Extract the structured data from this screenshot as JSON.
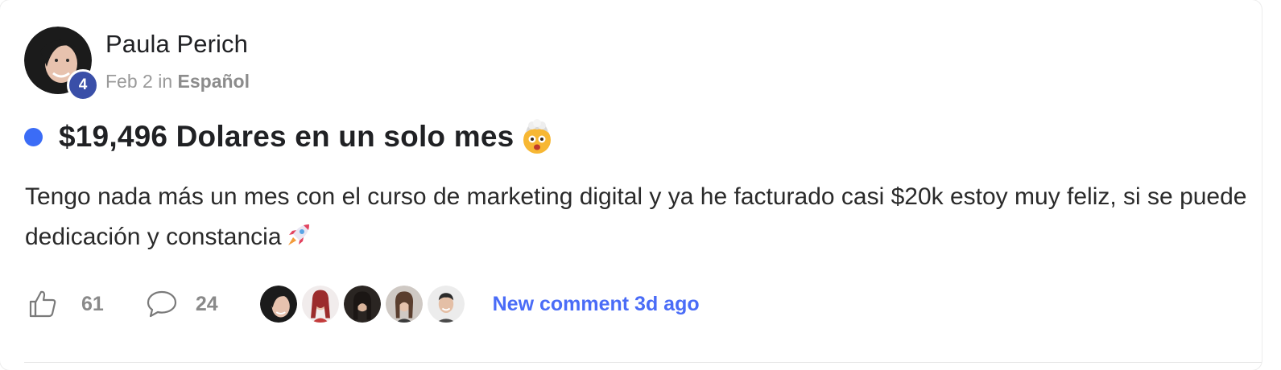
{
  "post": {
    "author": {
      "name": "Paula Perich",
      "level": "4",
      "avatar_icon": "user-avatar"
    },
    "meta": {
      "date": "Feb 2",
      "in_word": " in ",
      "category": "Español"
    },
    "unread_dot_color": "#3b6cf6",
    "title": "$19,496 Dolares en un solo mes",
    "title_emoji": "exploding-head-emoji",
    "body": "Tengo nada más un mes con el curso de marketing digital y ya he facturado casi $20k estoy muy feliz, si se puede dedicación y constancia",
    "body_emoji": "rocket-emoji",
    "likes": "61",
    "comments": "24",
    "commenter_avatars": [
      "avatar-1",
      "avatar-2",
      "avatar-3",
      "avatar-4",
      "avatar-5"
    ],
    "new_comment_label": "New comment 3d ago",
    "accent_color": "#4a6cf7"
  }
}
